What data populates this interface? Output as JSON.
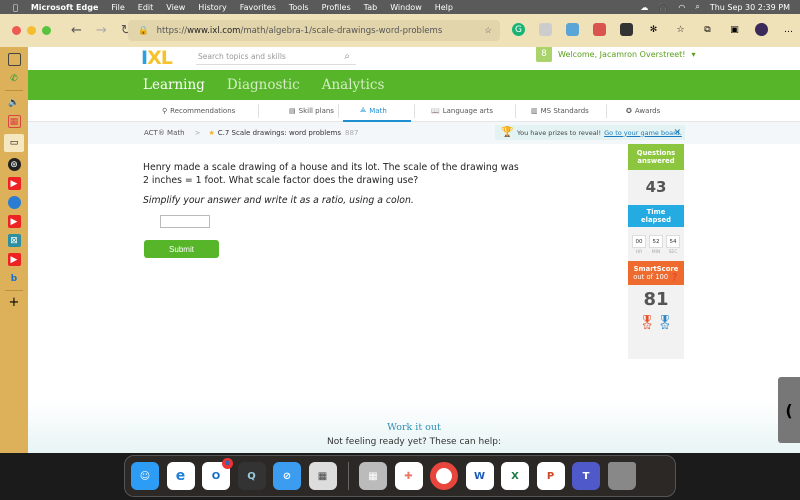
{
  "menubar": {
    "app": "Microsoft Edge",
    "items": [
      "File",
      "Edit",
      "View",
      "History",
      "Favorites",
      "Tools",
      "Profiles",
      "Tab",
      "Window",
      "Help"
    ],
    "datetime": "Thu Sep 30  2:39 PM"
  },
  "browser": {
    "url_prefix": "https://",
    "url_domain": "www.ixl.com",
    "url_path": "/math/algebra-1/scale-drawings-word-problems"
  },
  "ixl": {
    "logo": "IXL",
    "search_placeholder": "Search topics and skills",
    "welcome": "Welcome, Jacamron Overstreet!",
    "main_tabs": [
      "Learning",
      "Diagnostic",
      "Analytics"
    ],
    "sub_tabs": [
      "Recommendations",
      "Skill plans",
      "Math",
      "Language arts",
      "MS Standards",
      "Awards"
    ],
    "breadcrumb_subject": "ACT® Math",
    "breadcrumb_sep": ">",
    "skill": "C.7 Scale drawings: word problems",
    "skill_code": "887",
    "prize_text": "You have prizes to reveal!",
    "prize_link": "Go to your game board.",
    "question_line": "Henry made a scale drawing of a house and its lot. The scale of the drawing was 2 inches = 1 foot. What scale factor does the drawing use?",
    "instruction": "Simplify your answer and write it as a ratio, using a colon.",
    "answer_value": "",
    "submit": "Submit",
    "stats": {
      "questions_label_1": "Questions",
      "questions_label_2": "answered",
      "questions_value": "43",
      "time_label_1": "Time",
      "time_label_2": "elapsed",
      "hr": "00",
      "min": "52",
      "sec": "54",
      "hr_label": "HR",
      "min_label": "MIN",
      "sec_label": "SEC",
      "smartscore_label": "SmartScore",
      "smartscore_sub": "out of 100",
      "smartscore_value": "81"
    },
    "work_it_out": "Work it out",
    "not_ready": "Not feeling ready yet? These can help:"
  },
  "dock": {
    "outlook_badge": "8"
  }
}
